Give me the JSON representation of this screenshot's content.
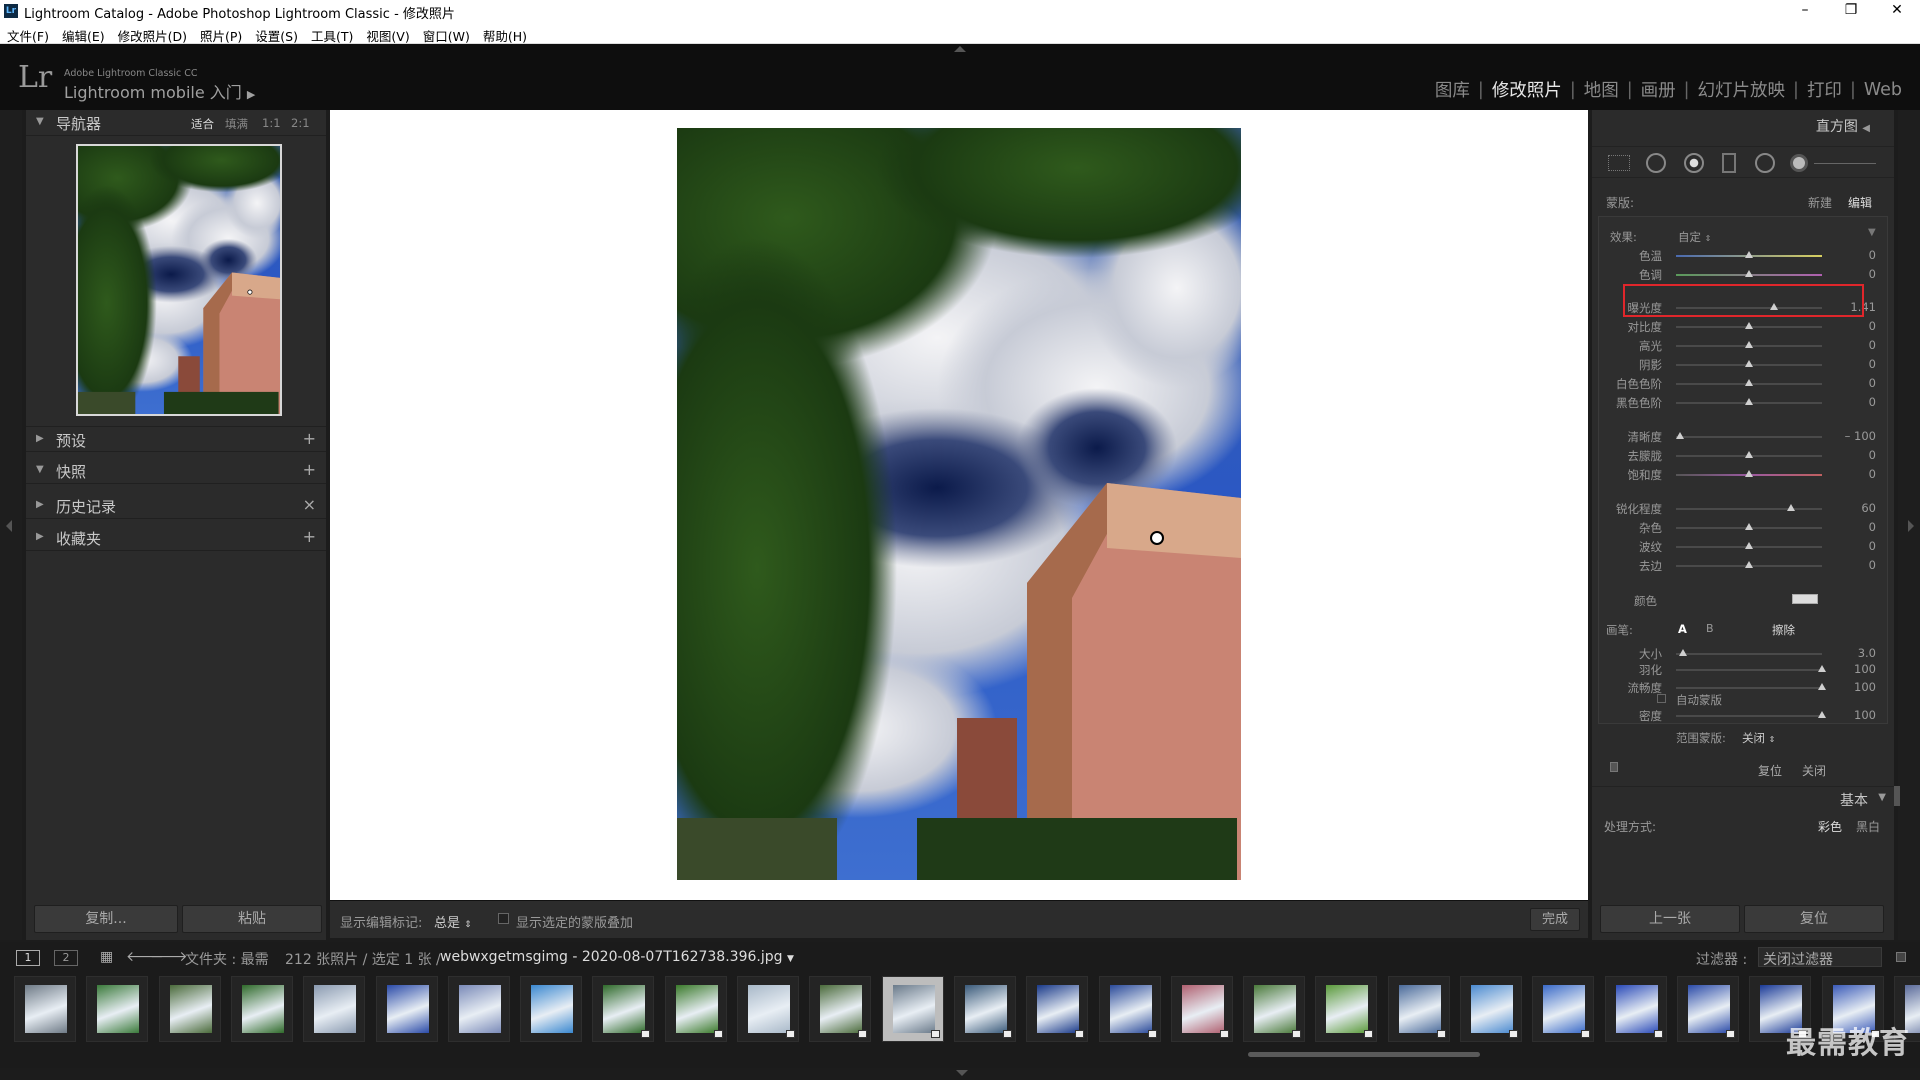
{
  "window": {
    "title": "Lightroom Catalog - Adobe Photoshop Lightroom Classic - 修改照片",
    "app_icon": "Lr"
  },
  "menu": [
    "文件(F)",
    "编辑(E)",
    "修改照片(D)",
    "照片(P)",
    "设置(S)",
    "工具(T)",
    "视图(V)",
    "窗口(W)",
    "帮助(H)"
  ],
  "identity": {
    "logo": "Lr",
    "line1": "Adobe Lightroom Classic CC",
    "line2": "Lightroom mobile 入门"
  },
  "modules": [
    {
      "label": "图库",
      "active": false
    },
    {
      "label": "修改照片",
      "active": true
    },
    {
      "label": "地图",
      "active": false
    },
    {
      "label": "画册",
      "active": false
    },
    {
      "label": "幻灯片放映",
      "active": false
    },
    {
      "label": "打印",
      "active": false
    },
    {
      "label": "Web",
      "active": false
    }
  ],
  "left_panel": {
    "navigator": {
      "title": "导航器",
      "zoom": [
        "适合",
        "填满",
        "1:1",
        "2:1"
      ]
    },
    "sections": [
      {
        "label": "预设",
        "action": "+"
      },
      {
        "label": "快照",
        "action": "+"
      },
      {
        "label": "历史记录",
        "action": "×"
      },
      {
        "label": "收藏夹",
        "action": "+"
      }
    ],
    "copy_button": "复制...",
    "paste_button": "粘贴"
  },
  "toolbar": {
    "show_edit_label": "显示编辑标记:",
    "show_edit_value": "总是",
    "overlay_label": "显示选定的蒙版叠加",
    "done_button": "完成"
  },
  "right_panel": {
    "histogram_label": "直方图",
    "mask_label": "蒙版:",
    "mask_new": "新建",
    "mask_edit": "编辑",
    "effect_label": "效果:",
    "effect_value": "自定",
    "sliders_group1": [
      {
        "label": "色温",
        "value": "0",
        "pos": 0.5
      },
      {
        "label": "色调",
        "value": "0",
        "pos": 0.5
      }
    ],
    "sliders_group2": [
      {
        "label": "曝光度",
        "value": "1.41",
        "pos": 0.67
      },
      {
        "label": "对比度",
        "value": "0",
        "pos": 0.5
      },
      {
        "label": "高光",
        "value": "0",
        "pos": 0.5
      },
      {
        "label": "阴影",
        "value": "0",
        "pos": 0.5
      },
      {
        "label": "白色色阶",
        "value": "0",
        "pos": 0.5
      },
      {
        "label": "黑色色阶",
        "value": "0",
        "pos": 0.5
      }
    ],
    "sliders_group3": [
      {
        "label": "清晰度",
        "value": "– 100",
        "pos": 0.03
      },
      {
        "label": "去朦胧",
        "value": "0",
        "pos": 0.5
      },
      {
        "label": "饱和度",
        "value": "0",
        "pos": 0.5
      }
    ],
    "sliders_group4": [
      {
        "label": "锐化程度",
        "value": "60",
        "pos": 0.79
      },
      {
        "label": "杂色",
        "value": "0",
        "pos": 0.5
      },
      {
        "label": "波纹",
        "value": "0",
        "pos": 0.5
      },
      {
        "label": "去边",
        "value": "0",
        "pos": 0.5
      }
    ],
    "color_label": "颜色",
    "brush_label": "画笔:",
    "brush_a": "A",
    "brush_b": "B",
    "brush_erase": "擦除",
    "brush_sliders": [
      {
        "label": "大小",
        "value": "3.0",
        "pos": 0.05
      },
      {
        "label": "羽化",
        "value": "100",
        "pos": 1.0
      },
      {
        "label": "流畅度",
        "value": "100",
        "pos": 1.0
      }
    ],
    "auto_mask": "自动蒙版",
    "density": {
      "label": "密度",
      "value": "100",
      "pos": 1.0
    },
    "range_mask_label": "范围蒙版:",
    "range_mask_value": "关闭",
    "reset": "复位",
    "close": "关闭",
    "basic_label": "基本",
    "treatment_label": "处理方式:",
    "treatment_color": "彩色",
    "treatment_bw": "黑白",
    "prev_button": "上一张",
    "reset_button": "复位"
  },
  "filmstrip_header": {
    "view1": "1",
    "view2": "2",
    "source": "文件夹 : 最需",
    "count": "212 张照片 / 选定 1 张 /",
    "filename": "webwxgetmsgimg - 2020-08-07T162738.396.jpg",
    "filter_label": "过滤器 :",
    "filter_value": "关闭过滤器"
  },
  "watermark": "最需教育",
  "colors": {
    "highlight_box": "#e0262b",
    "panel_bg": "#2b2b2b",
    "canvas_bg": "#ffffff"
  }
}
